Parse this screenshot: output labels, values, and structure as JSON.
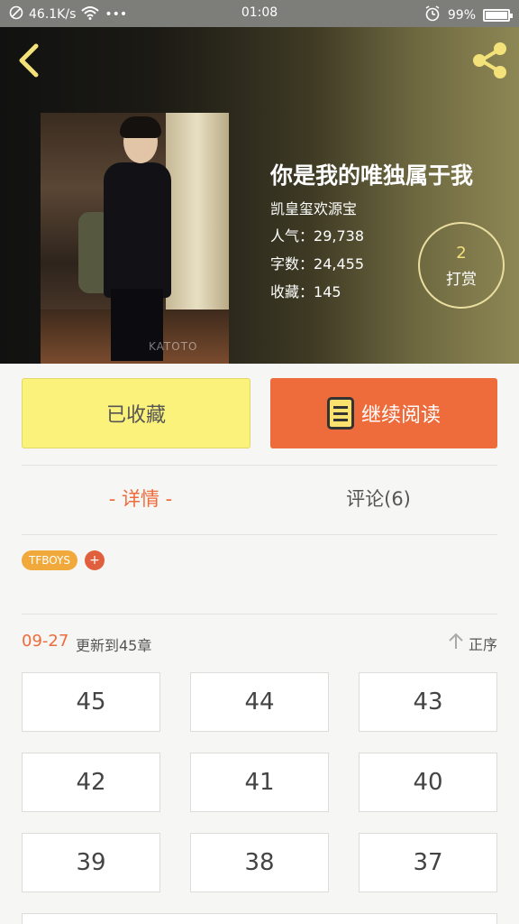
{
  "status_bar": {
    "speed": "46.1K/s",
    "dots": "•••",
    "time": "01:08",
    "battery_percent": "99%",
    "battery_level": 0.99,
    "icons": [
      "block-icon",
      "wifi-icon",
      "alarm-icon",
      "battery-icon"
    ]
  },
  "header": {
    "back_icon": "chevron-left-icon",
    "share_icon": "share-icon"
  },
  "book": {
    "title": "你是我的唯独属于我",
    "author": "凯皇玺欢源宝",
    "popularity_label": "人气：",
    "popularity": "29,738",
    "words_label": "字数：",
    "words": "24,455",
    "favorites_label": "收藏：",
    "favorites": "145",
    "cover_watermark": "KATOTO"
  },
  "tip": {
    "count": "2",
    "label": "打赏"
  },
  "actions": {
    "collect_label": "已收藏",
    "read_label": "继续阅读",
    "read_icon": "book-icon"
  },
  "tabs": {
    "detail_label": "- 详情 -",
    "comments_label": "评论(6)"
  },
  "tags": {
    "items": [
      "TFBOYS"
    ],
    "add_label": "+"
  },
  "update": {
    "date": "09-27",
    "text": "更新到45章",
    "sort_label": "正序",
    "sort_icon": "arrow-up-icon"
  },
  "chapters": [
    "45",
    "44",
    "43",
    "42",
    "41",
    "40",
    "39",
    "38",
    "37"
  ],
  "colors": {
    "accent": "#ee6b3b",
    "collect_bg": "#fbf27c",
    "tag_bg": "#f2a93b",
    "tip_count": "#f3e27a"
  }
}
